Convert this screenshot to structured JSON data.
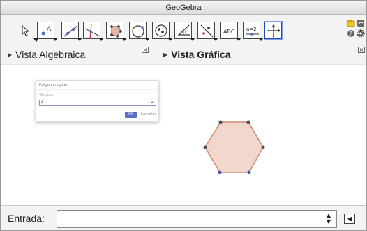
{
  "window": {
    "title": "GeoGebra"
  },
  "toolbar": {
    "tools": [
      {
        "name": "Move",
        "icon": "cursor-arrow-icon"
      },
      {
        "name": "Point",
        "icon": "point-icon"
      },
      {
        "name": "Line",
        "icon": "line-icon"
      },
      {
        "name": "Perpendicular",
        "icon": "perpendicular-icon"
      },
      {
        "name": "Polygon",
        "icon": "polygon-icon"
      },
      {
        "name": "Circle",
        "icon": "circle-icon"
      },
      {
        "name": "Ellipse",
        "icon": "conic-icon"
      },
      {
        "name": "Angle",
        "icon": "angle-icon"
      },
      {
        "name": "Reflect",
        "icon": "reflect-icon"
      },
      {
        "name": "Text",
        "icon": "text-tool-icon",
        "label": "ABC"
      },
      {
        "name": "Slider",
        "icon": "slider-icon",
        "label": "a=2"
      },
      {
        "name": "Move Graphics View",
        "icon": "move-view-icon",
        "selected": true
      }
    ],
    "text_tool_label": "ABC",
    "slider_tool_label": "a=2"
  },
  "views": {
    "algebra_title": "Vista Algebraica",
    "graphics_title": "Vista Gráfica",
    "close_glyph": "×"
  },
  "dialog": {
    "title": "Polígono regular",
    "label": "Vértices",
    "value": "4",
    "ok": "OK",
    "cancel": "Cancelar"
  },
  "input_bar": {
    "label": "Entrada:",
    "value": ""
  },
  "colors": {
    "hexagon_fill": "#f3d7cc",
    "hexagon_stroke": "#c98a70",
    "point_dark": "#555555",
    "point_blue": "#4a5ab8",
    "accent": "#1f48b8"
  }
}
